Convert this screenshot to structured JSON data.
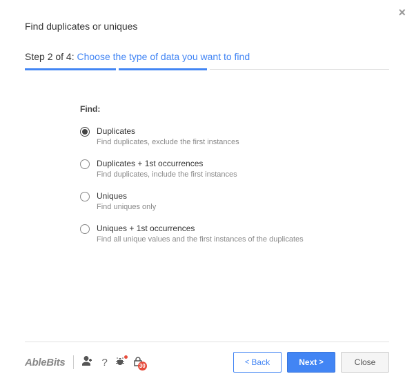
{
  "title": "Find duplicates or uniques",
  "step": {
    "prefix": "Step 2 of 4: ",
    "instruction": "Choose the type of data you want to find"
  },
  "find_label": "Find:",
  "options": [
    {
      "label": "Duplicates",
      "desc": "Find duplicates, exclude the first instances",
      "selected": true
    },
    {
      "label": "Duplicates + 1st occurrences",
      "desc": "Find duplicates, include the first instances",
      "selected": false
    },
    {
      "label": "Uniques",
      "desc": "Find uniques only",
      "selected": false
    },
    {
      "label": "Uniques + 1st occurrences",
      "desc": "Find all unique values and the first instances of the duplicates",
      "selected": false
    }
  ],
  "footer": {
    "logo": "AbleBits",
    "trial_badge": "30",
    "back": "Back",
    "next": "Next",
    "close": "Close"
  }
}
